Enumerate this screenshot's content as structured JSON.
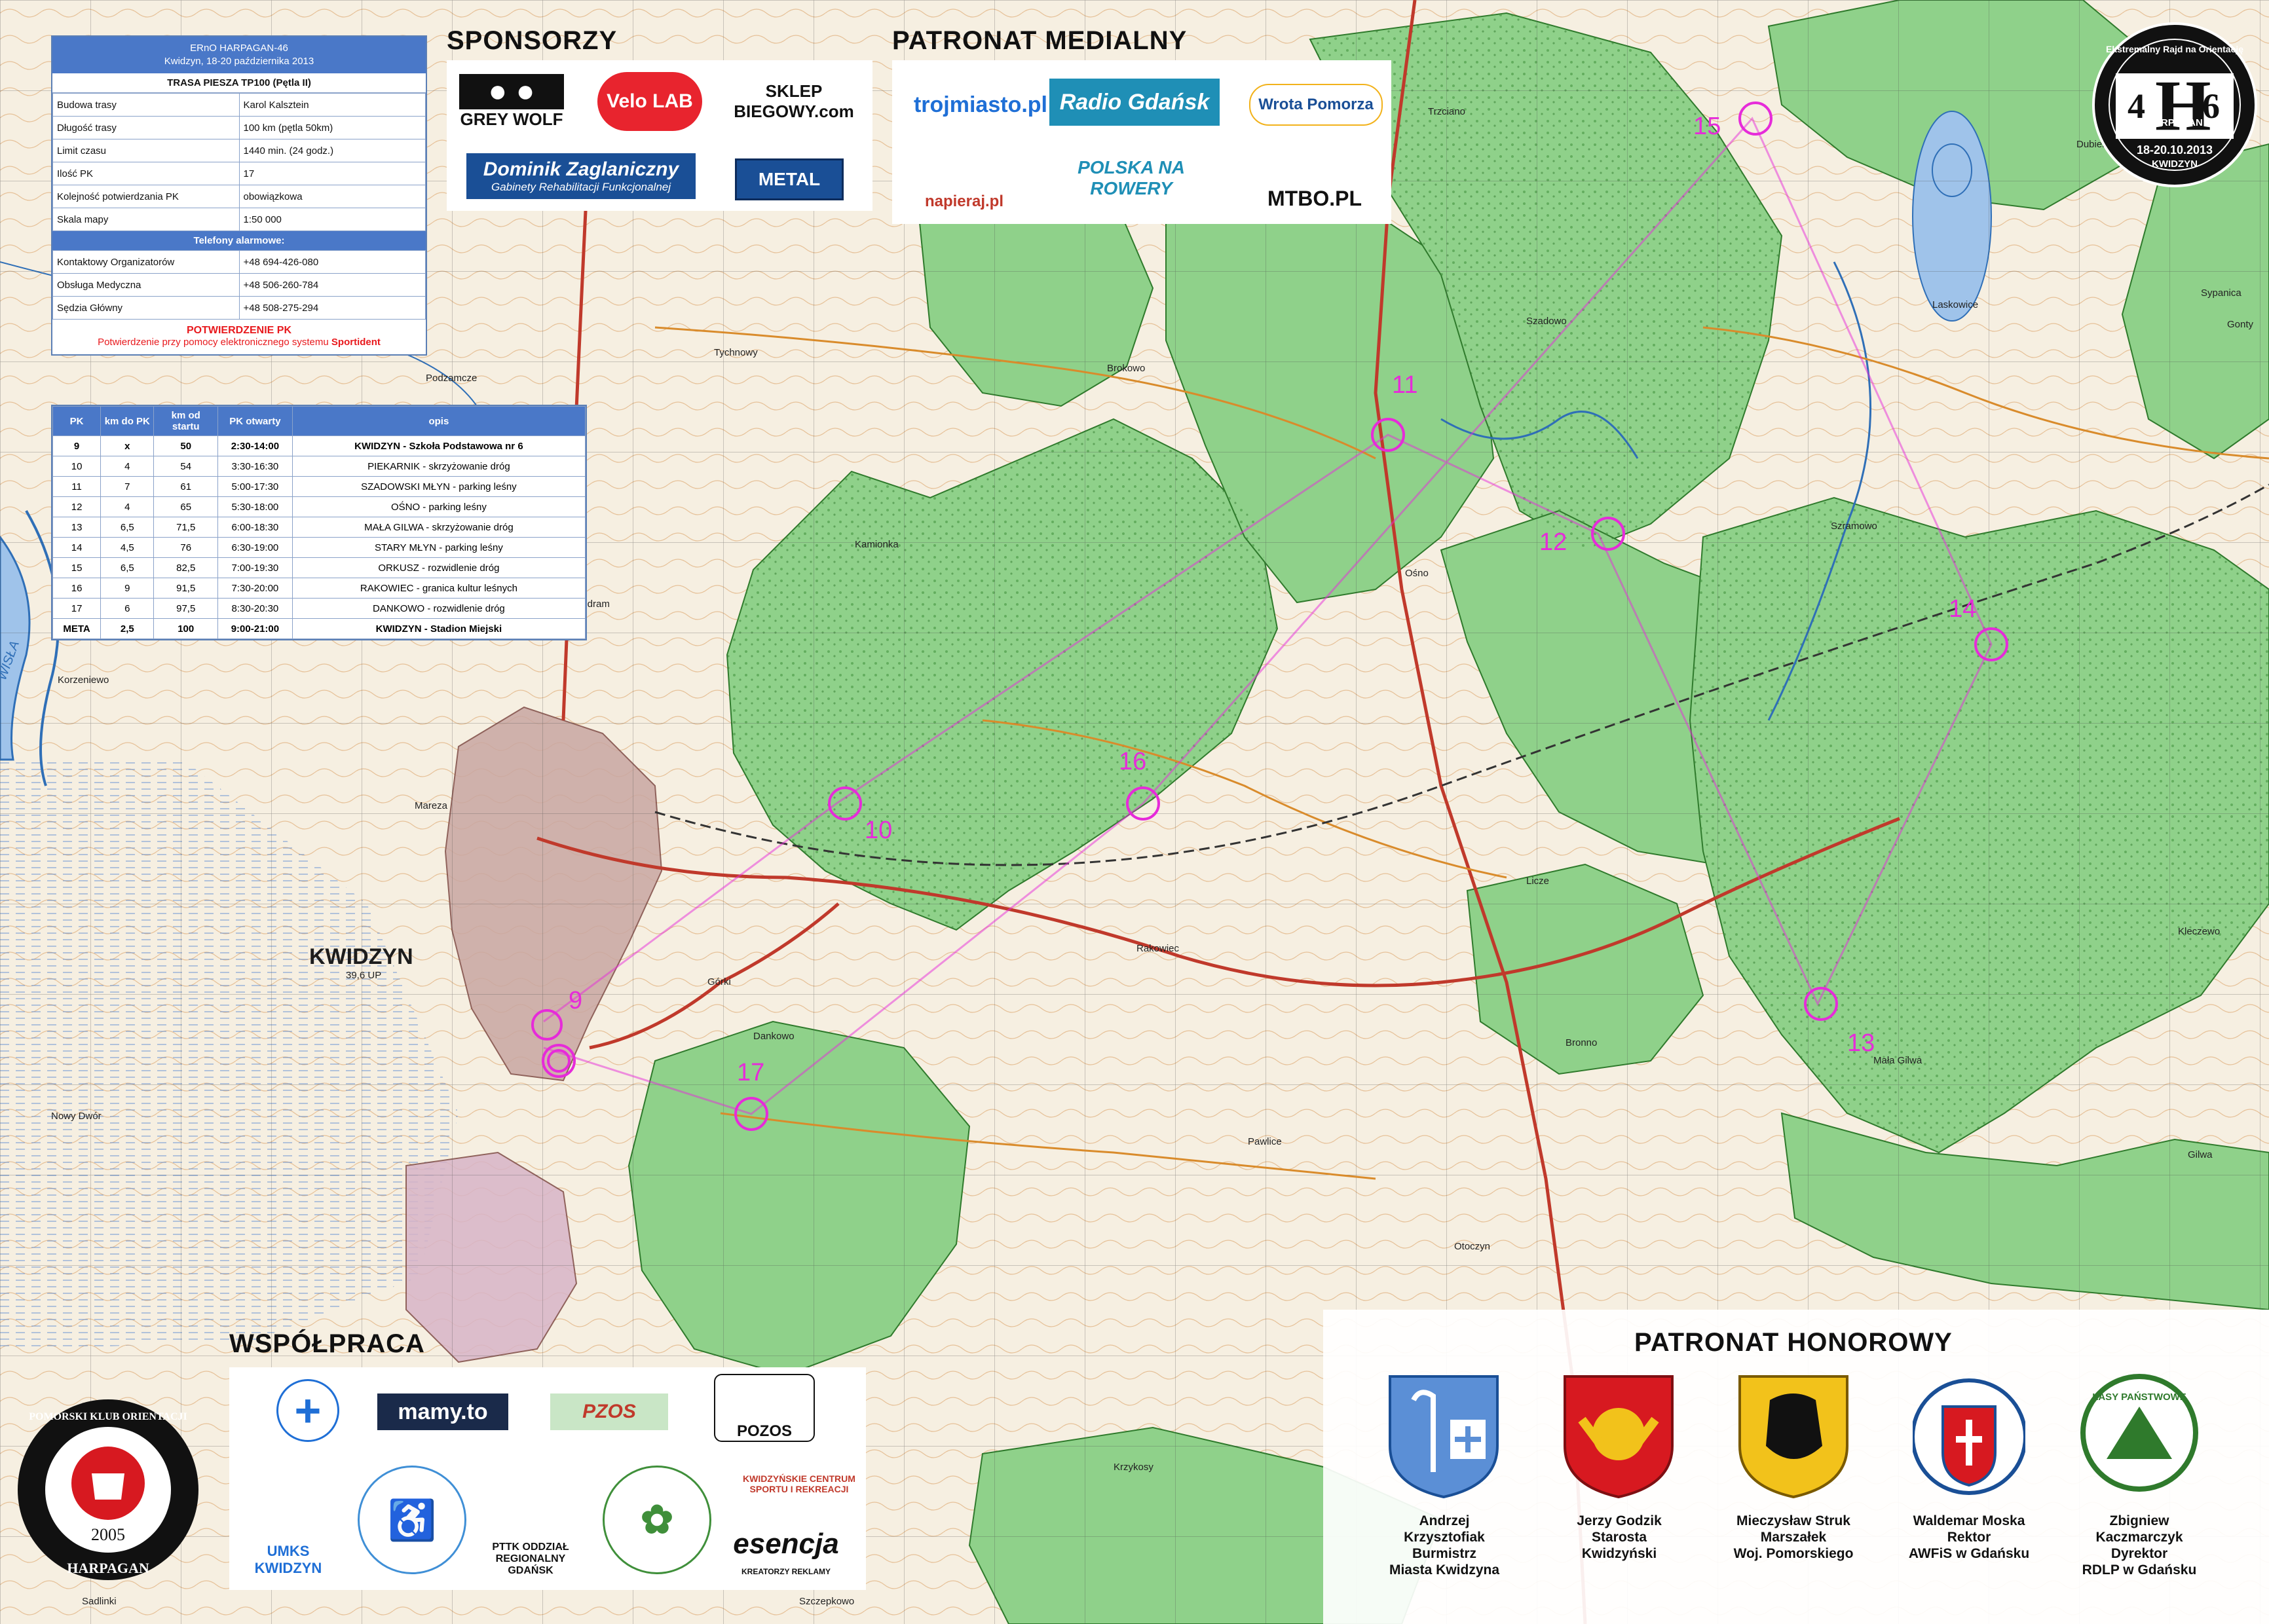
{
  "event": {
    "title": "ERnO HARPAGAN-46",
    "date_line": "Kwidzyn, 18-20 października 2013",
    "route_title": "TRASA PIESZA TP100 (Pętla II)"
  },
  "info_rows": [
    {
      "label": "Budowa trasy",
      "value": "Karol Kalsztein"
    },
    {
      "label": "Długość trasy",
      "value": "100 km (pętla 50km)"
    },
    {
      "label": "Limit czasu",
      "value": "1440 min. (24 godz.)"
    },
    {
      "label": "Ilość PK",
      "value": "17"
    },
    {
      "label": "Kolejność potwierdzania PK",
      "value": "obowiązkowa"
    },
    {
      "label": "Skala mapy",
      "value": "1:50 000"
    }
  ],
  "phones_title": "Telefony alarmowe:",
  "phones": [
    {
      "label": "Kontaktowy Organizatorów",
      "value": "+48 694-426-080"
    },
    {
      "label": "Obsługa Medyczna",
      "value": "+48 506-260-784"
    },
    {
      "label": "Sędzia Główny",
      "value": "+48 508-275-294"
    }
  ],
  "confirm": {
    "title": "POTWIERDZENIE PK",
    "text_prefix": "Potwierdzenie przy pomocy elektronicznego systemu ",
    "text_bold": "Sportident"
  },
  "cp_table": {
    "headers": [
      "PK",
      "km do PK",
      "km od startu",
      "PK otwarty",
      "opis"
    ],
    "rows": [
      [
        "9",
        "x",
        "50",
        "2:30-14:00",
        "KWIDZYN - Szkoła Podstawowa nr 6"
      ],
      [
        "10",
        "4",
        "54",
        "3:30-16:30",
        "PIEKARNIK - skrzyżowanie dróg"
      ],
      [
        "11",
        "7",
        "61",
        "5:00-17:30",
        "SZADOWSKI MŁYN - parking leśny"
      ],
      [
        "12",
        "4",
        "65",
        "5:30-18:00",
        "OŚNO - parking leśny"
      ],
      [
        "13",
        "6,5",
        "71,5",
        "6:00-18:30",
        "MAŁA GILWA - skrzyżowanie dróg"
      ],
      [
        "14",
        "4,5",
        "76",
        "6:30-19:00",
        "STARY MŁYN - parking leśny"
      ],
      [
        "15",
        "6,5",
        "82,5",
        "7:00-19:30",
        "ORKUSZ - rozwidlenie dróg"
      ],
      [
        "16",
        "9",
        "91,5",
        "7:30-20:00",
        "RAKOWIEC - granica kultur leśnych"
      ],
      [
        "17",
        "6",
        "97,5",
        "8:30-20:30",
        "DANKOWO - rozwidlenie dróg"
      ],
      [
        "META",
        "2,5",
        "100",
        "9:00-21:00",
        "KWIDZYN - Stadion Miejski"
      ]
    ]
  },
  "sections": {
    "sponsors": "SPONSORZY",
    "media": "PATRONAT MEDIALNY",
    "cooperation": "WSPÓŁPRACA",
    "honorary": "PATRONAT HONOROWY"
  },
  "sponsor_logos": [
    "GREY WOLF",
    "Velo LAB",
    "SKLEP BIEGOWY.com",
    "Dominik Zaglaniczny",
    "Gabinety Rehabilitacji Funkcjonalnej",
    "METAL"
  ],
  "media_logos": [
    "trojmiasto.pl",
    "Radio Gdańsk",
    "Wrota Pomorza",
    "napieraj.pl",
    "POLSKA NA ROWERY",
    "MTBO.PL"
  ],
  "coop_logos": [
    "mamy.to",
    "PZOS",
    "POZOS",
    "UMKS KWIDZYN",
    "PTTK ODDZIAŁ REGIONALNY GDAŃSK",
    "esencja",
    "KREATORZY REKLAMY",
    "KWIDZYŃSKIE CENTRUM SPORTU I REKREACJI"
  ],
  "honorary": [
    {
      "name": "Andrzej Krzysztofiak",
      "role1": "Burmistrz",
      "role2": "Miasta Kwidzyna"
    },
    {
      "name": "Jerzy Godzik",
      "role1": "Starosta",
      "role2": "Kwidzyński"
    },
    {
      "name": "Mieczysław Struk",
      "role1": "Marszałek",
      "role2": "Woj. Pomorskiego"
    },
    {
      "name": "Waldemar Moska",
      "role1": "Rektor",
      "role2": "AWFiS w Gdańsku"
    },
    {
      "name": "Zbigniew Kaczmarczyk",
      "role1": "Dyrektor",
      "role2": "RDLP w Gdańsku"
    }
  ],
  "forest_logo_text": "LASY PAŃSTWOWE",
  "badge": {
    "ring_text": "Ekstremalny Rajd na Orientację",
    "left_num": "4",
    "letter": "H",
    "right_num": "6",
    "name": "HARPAGAN",
    "dates": "18-20.10.2013",
    "city": "KWIDZYN"
  },
  "club_logo": {
    "ring_text": "POMORSKI KLUB ORIENTACJI",
    "year": "2005",
    "name": "HARPAGAN"
  },
  "checkpoints": [
    {
      "num": "9"
    },
    {
      "num": "10"
    },
    {
      "num": "11"
    },
    {
      "num": "12"
    },
    {
      "num": "13"
    },
    {
      "num": "14"
    },
    {
      "num": "15"
    },
    {
      "num": "16"
    },
    {
      "num": "17"
    }
  ],
  "places": {
    "kwidzyn": "KWIDZYN",
    "kwidzyn_elev": "39,6 UP",
    "tychnowy": "Tychnowy",
    "podzamcze": "Podzamcze",
    "baldram": "Baldram",
    "korzeniewo": "Korzeniewo",
    "marezy": "Mareza",
    "nowy_dwor": "Nowy Dwór",
    "gorki": "Górki",
    "dankowo": "Dankowo",
    "rakowiec": "Rakowiec",
    "brokowo": "Brokowo",
    "kamionka": "Kamionka",
    "osno": "Ośno",
    "trzciano": "Trzciano",
    "szadowo": "Szadowo",
    "laskowice": "Laskowice",
    "szramowo": "Szramowo",
    "licze": "Licze",
    "bronno": "Bronno",
    "pawlice": "Pawlice",
    "otoczyn": "Otoczyn",
    "krzykosy": "Krzykosy",
    "mala_gilwa": "Mała Gilwa",
    "gilwa": "Gilwa",
    "kleczewo": "Kleczewo",
    "sypanica": "Sypanica",
    "wisla": "WISŁA",
    "dubiel": "Dubiel",
    "gonty": "Gonty",
    "szczepkowo": "Szczepkowo",
    "sadlinki": "Sadlinki"
  }
}
